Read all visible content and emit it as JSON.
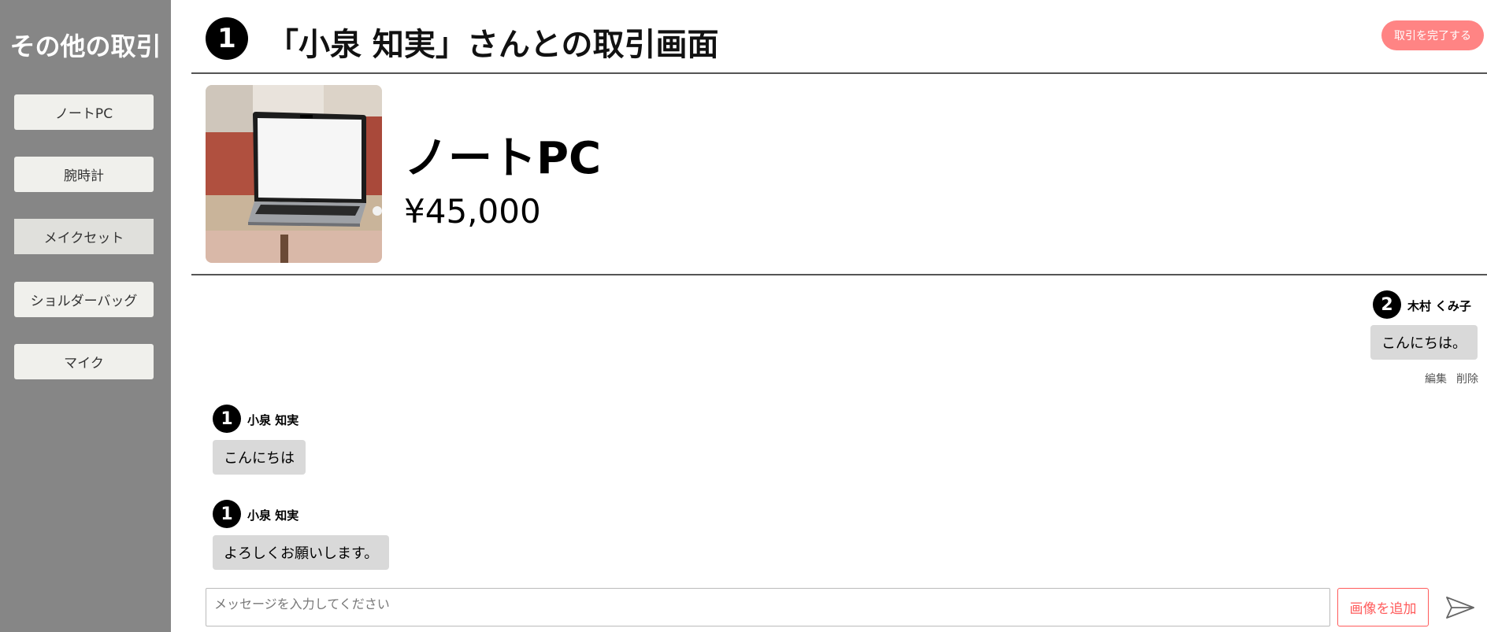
{
  "sidebar": {
    "title": "その他の取引",
    "items": [
      {
        "label": "ノートPC"
      },
      {
        "label": "腕時計"
      },
      {
        "label": "メイクセット"
      },
      {
        "label": "ショルダーバッグ"
      },
      {
        "label": "マイク"
      }
    ]
  },
  "header": {
    "partner_avatar_number": "1",
    "title": "「小泉 知実」さんとの取引画面",
    "complete_button": "取引を完了する"
  },
  "product": {
    "name": "ノートPC",
    "price": "¥45,000"
  },
  "messages": [
    {
      "avatar": "2",
      "name": "木村 くみ子",
      "text": "こんにちは。",
      "edit": "編集",
      "delete": "削除"
    },
    {
      "avatar": "1",
      "name": "小泉 知実",
      "text": "こんにちは"
    },
    {
      "avatar": "1",
      "name": "小泉 知実",
      "text": "よろしくお願いします。"
    }
  ],
  "composer": {
    "placeholder": "メッセージを入力してください",
    "add_image": "画像を追加"
  },
  "colors": {
    "sidebar_bg": "#868686",
    "accent": "#ff8484",
    "bubble_bg": "#d9d9d9"
  },
  "icons": {
    "send": "paper-plane-icon"
  }
}
